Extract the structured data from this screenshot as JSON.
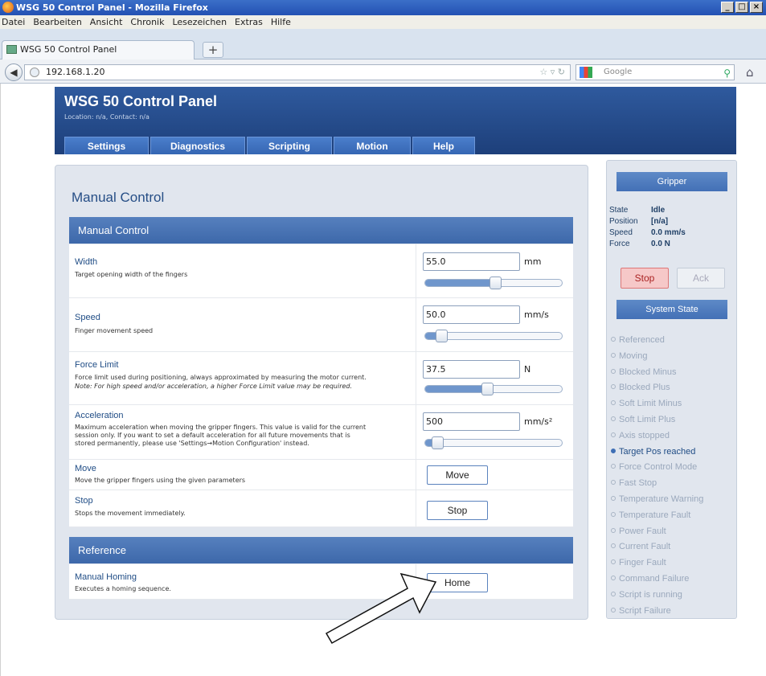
{
  "window": {
    "title": "WSG 50 Control Panel - Mozilla Firefox"
  },
  "menu": [
    "Datei",
    "Bearbeiten",
    "Ansicht",
    "Chronik",
    "Lesezeichen",
    "Extras",
    "Hilfe"
  ],
  "tab": {
    "title": "WSG 50 Control Panel",
    "new_tab": "+"
  },
  "url": "192.168.1.20",
  "search_placeholder": "Google",
  "banner": {
    "title": "WSG 50 Control Panel",
    "location": "Location: n/a, Contact: n/a"
  },
  "nav": [
    "Settings",
    "Diagnostics",
    "Scripting",
    "Motion",
    "Help"
  ],
  "main": {
    "heading": "Manual Control",
    "section1": "Manual Control",
    "width": {
      "label": "Width",
      "desc": "Target opening width of the fingers",
      "value": "55.0",
      "unit": "mm",
      "slider": 0.51
    },
    "speed": {
      "label": "Speed",
      "desc": "Finger movement speed",
      "value": "50.0",
      "unit": "mm/s",
      "slider": 0.12
    },
    "force": {
      "label": "Force Limit",
      "desc": "Force limit used during positioning, always approximated by measuring the motor current.",
      "note": "Note: For high speed and/or acceleration, a higher Force Limit value may be required.",
      "value": "37.5",
      "unit": "N",
      "slider": 0.45
    },
    "accel": {
      "label": "Acceleration",
      "desc1": "Maximum acceleration when moving the gripper fingers. This value is valid for the current",
      "desc2": "session only. If you want to set a default acceleration for all future movements that is",
      "desc3": "stored permanently, please use 'Settings→Motion Configuration' instead.",
      "value": "500",
      "unit": "mm/s²",
      "slider": 0.09
    },
    "move": {
      "label": "Move",
      "desc": "Move the gripper fingers using the given parameters",
      "button": "Move"
    },
    "stop": {
      "label": "Stop",
      "desc": "Stops the movement immediately.",
      "button": "Stop"
    },
    "section2": "Reference",
    "homing": {
      "label": "Manual Homing",
      "desc": "Executes a homing sequence.",
      "button": "Home"
    }
  },
  "gripper": {
    "header": "Gripper",
    "state_label": "State",
    "state": "Idle",
    "position_label": "Position",
    "position": "[n/a]",
    "speed_label": "Speed",
    "speed": "0.0 mm/s",
    "force_label": "Force",
    "force": "0.0 N",
    "stop": "Stop",
    "ack": "Ack"
  },
  "system_state": {
    "header": "System State",
    "items": [
      {
        "label": "Referenced",
        "active": false
      },
      {
        "label": "Moving",
        "active": false
      },
      {
        "label": "Blocked Minus",
        "active": false
      },
      {
        "label": "Blocked Plus",
        "active": false
      },
      {
        "label": "Soft Limit Minus",
        "active": false
      },
      {
        "label": "Soft Limit Plus",
        "active": false
      },
      {
        "label": "Axis stopped",
        "active": false
      },
      {
        "label": "Target Pos reached",
        "active": true
      },
      {
        "label": "Force Control Mode",
        "active": false
      },
      {
        "label": "Fast Stop",
        "active": false
      },
      {
        "label": "Temperature Warning",
        "active": false
      },
      {
        "label": "Temperature Fault",
        "active": false
      },
      {
        "label": "Power Fault",
        "active": false
      },
      {
        "label": "Current Fault",
        "active": false
      },
      {
        "label": "Finger Fault",
        "active": false
      },
      {
        "label": "Command Failure",
        "active": false
      },
      {
        "label": "Script is running",
        "active": false
      },
      {
        "label": "Script Failure",
        "active": false
      }
    ]
  }
}
